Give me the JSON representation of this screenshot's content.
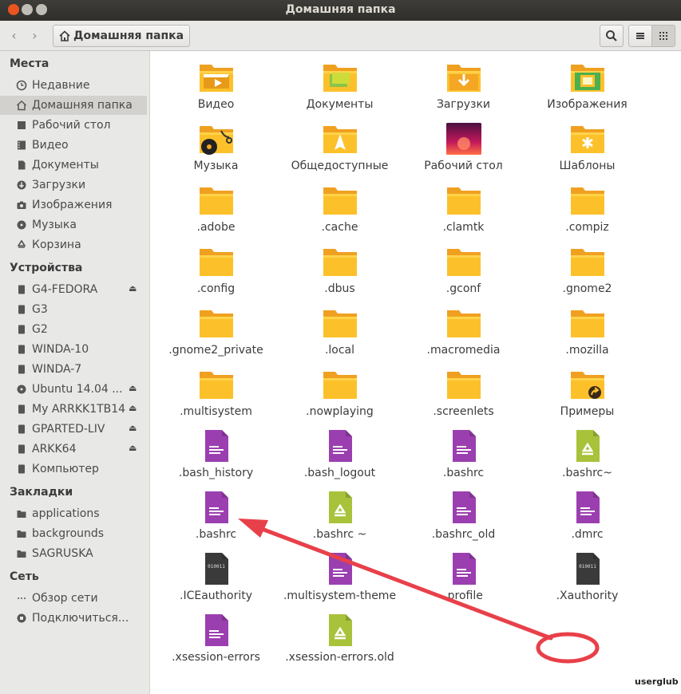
{
  "window": {
    "title": "Домашняя папка"
  },
  "toolbar": {
    "back_icon": "‹",
    "forward_icon": "›",
    "path_label": "Домашняя папка"
  },
  "sidebar": {
    "sections": [
      {
        "title": "Места",
        "items": [
          {
            "label": "Недавние",
            "icon": "clock-icon"
          },
          {
            "label": "Домашняя папка",
            "icon": "home-icon",
            "active": true
          },
          {
            "label": "Рабочий стол",
            "icon": "desktop-icon"
          },
          {
            "label": "Видео",
            "icon": "video-icon"
          },
          {
            "label": "Документы",
            "icon": "document-icon"
          },
          {
            "label": "Загрузки",
            "icon": "download-icon"
          },
          {
            "label": "Изображения",
            "icon": "camera-icon"
          },
          {
            "label": "Музыка",
            "icon": "music-icon"
          },
          {
            "label": "Корзина",
            "icon": "trash-icon"
          }
        ]
      },
      {
        "title": "Устройства",
        "items": [
          {
            "label": "G4-FEDORA",
            "icon": "drive-icon",
            "eject": true
          },
          {
            "label": "G3",
            "icon": "drive-icon"
          },
          {
            "label": "G2",
            "icon": "drive-icon"
          },
          {
            "label": "WINDA-10",
            "icon": "drive-icon"
          },
          {
            "label": "WINDA-7",
            "icon": "drive-icon"
          },
          {
            "label": "Ubuntu 14.04 ...",
            "icon": "disc-icon",
            "eject": true
          },
          {
            "label": "My ARRKK1TB14",
            "icon": "drive-icon",
            "eject": true
          },
          {
            "label": "GPARTED-LIV",
            "icon": "drive-icon",
            "eject": true
          },
          {
            "label": "ARKK64",
            "icon": "drive-icon",
            "eject": true
          },
          {
            "label": "Компьютер",
            "icon": "drive-icon"
          }
        ]
      },
      {
        "title": "Закладки",
        "items": [
          {
            "label": "applications",
            "icon": "folder-icon"
          },
          {
            "label": "backgrounds",
            "icon": "folder-icon"
          },
          {
            "label": "SAGRUSKA",
            "icon": "folder-icon"
          }
        ]
      },
      {
        "title": "Сеть",
        "items": [
          {
            "label": "Обзор сети",
            "icon": "network-icon"
          },
          {
            "label": "Подключиться...",
            "icon": "connect-icon"
          }
        ]
      }
    ],
    "eject_glyph": "⏏"
  },
  "files": [
    {
      "name": "Видео",
      "type": "folder-video"
    },
    {
      "name": "Документы",
      "type": "folder-documents"
    },
    {
      "name": "Загрузки",
      "type": "folder-downloads"
    },
    {
      "name": "Изображения",
      "type": "folder-pictures"
    },
    {
      "name": "Музыка",
      "type": "folder-music"
    },
    {
      "name": "Общедоступные",
      "type": "folder-public"
    },
    {
      "name": "Рабочий стол",
      "type": "folder-desktop"
    },
    {
      "name": "Шаблоны",
      "type": "folder-templates"
    },
    {
      "name": ".adobe",
      "type": "folder"
    },
    {
      "name": ".cache",
      "type": "folder"
    },
    {
      "name": ".clamtk",
      "type": "folder"
    },
    {
      "name": ".compiz",
      "type": "folder"
    },
    {
      "name": ".config",
      "type": "folder"
    },
    {
      "name": ".dbus",
      "type": "folder"
    },
    {
      "name": ".gconf",
      "type": "folder"
    },
    {
      "name": ".gnome2",
      "type": "folder"
    },
    {
      "name": ".gnome2_private",
      "type": "folder"
    },
    {
      "name": ".local",
      "type": "folder"
    },
    {
      "name": ".macromedia",
      "type": "folder"
    },
    {
      "name": ".mozilla",
      "type": "folder"
    },
    {
      "name": ".multisystem",
      "type": "folder"
    },
    {
      "name": ".nowplaying",
      "type": "folder"
    },
    {
      "name": ".screenlets",
      "type": "folder"
    },
    {
      "name": "Примеры",
      "type": "folder-link"
    },
    {
      "name": ".bash_history",
      "type": "text"
    },
    {
      "name": ".bash_logout",
      "type": "text"
    },
    {
      "name": ".bashrc",
      "type": "text"
    },
    {
      "name": ".bashrc~",
      "type": "backup"
    },
    {
      "name": ".bashrc",
      "type": "text"
    },
    {
      "name": ".bashrc ~",
      "type": "backup"
    },
    {
      "name": ".bashrc_old",
      "type": "text"
    },
    {
      "name": ".dmrc",
      "type": "text"
    },
    {
      "name": ".ICEauthority",
      "type": "binary"
    },
    {
      "name": ".multisystem-theme",
      "type": "text"
    },
    {
      "name": ".profile",
      "type": "text"
    },
    {
      "name": ".Xauthority",
      "type": "binary"
    },
    {
      "name": ".xsession-errors",
      "type": "text"
    },
    {
      "name": ".xsession-errors.old",
      "type": "backup"
    }
  ],
  "annotation": {
    "color": "#e8404a"
  },
  "binary_glyph": "010011",
  "watermark": "userglub"
}
